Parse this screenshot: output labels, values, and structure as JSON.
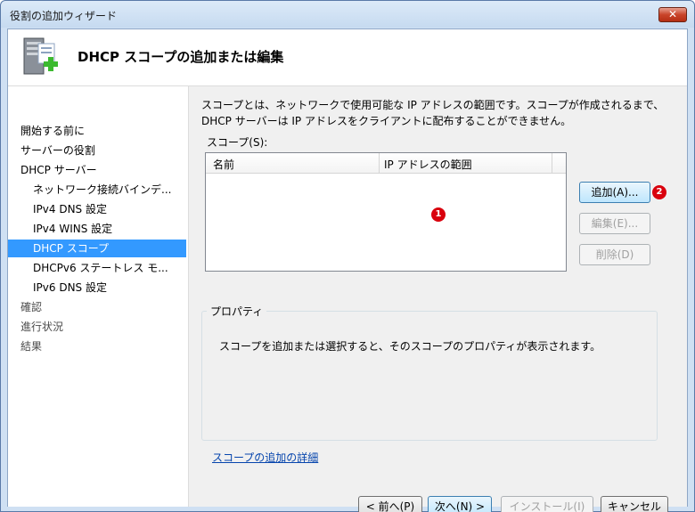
{
  "window": {
    "title": "役割の追加ウィザード",
    "close_label": "✕"
  },
  "header": {
    "title": "DHCP スコープの追加または編集",
    "icon": "server-add-icon"
  },
  "nav": {
    "items": [
      {
        "label": "開始する前に"
      },
      {
        "label": "サーバーの役割"
      },
      {
        "label": "DHCP サーバー"
      },
      {
        "label": "ネットワーク接続バインデ..."
      },
      {
        "label": "IPv4 DNS 設定"
      },
      {
        "label": "IPv4 WINS 設定"
      },
      {
        "label": "DHCP スコープ"
      },
      {
        "label": "DHCPv6 ステートレス モ..."
      },
      {
        "label": "IPv6 DNS 設定"
      },
      {
        "label": "確認"
      },
      {
        "label": "進行状況"
      },
      {
        "label": "結果"
      }
    ]
  },
  "main": {
    "description": "スコープとは、ネットワークで使用可能な IP アドレスの範囲です。スコープが作成されるまで、DHCP サーバーは IP アドレスをクライアントに配布することができません。",
    "scope_label": "スコープ(S):",
    "columns": [
      "名前",
      "IP アドレスの範囲"
    ],
    "add_button": "追加(A)...",
    "edit_button": "編集(E)...",
    "delete_button": "削除(D)",
    "properties_title": "プロパティ",
    "properties_text": "スコープを追加または選択すると、そのスコープのプロパティが表示されます。",
    "detail_link": "スコープの追加の詳細",
    "marker1": "1",
    "marker2": "2"
  },
  "footer": {
    "back_button": "< 前へ(P)",
    "next_button": "次へ(N) >",
    "install_button": "インストール(I)",
    "cancel_button": "キャンセル"
  },
  "colors": {
    "active_nav": "#3399ff",
    "marker": "#d9000d",
    "link": "#0645ad"
  }
}
